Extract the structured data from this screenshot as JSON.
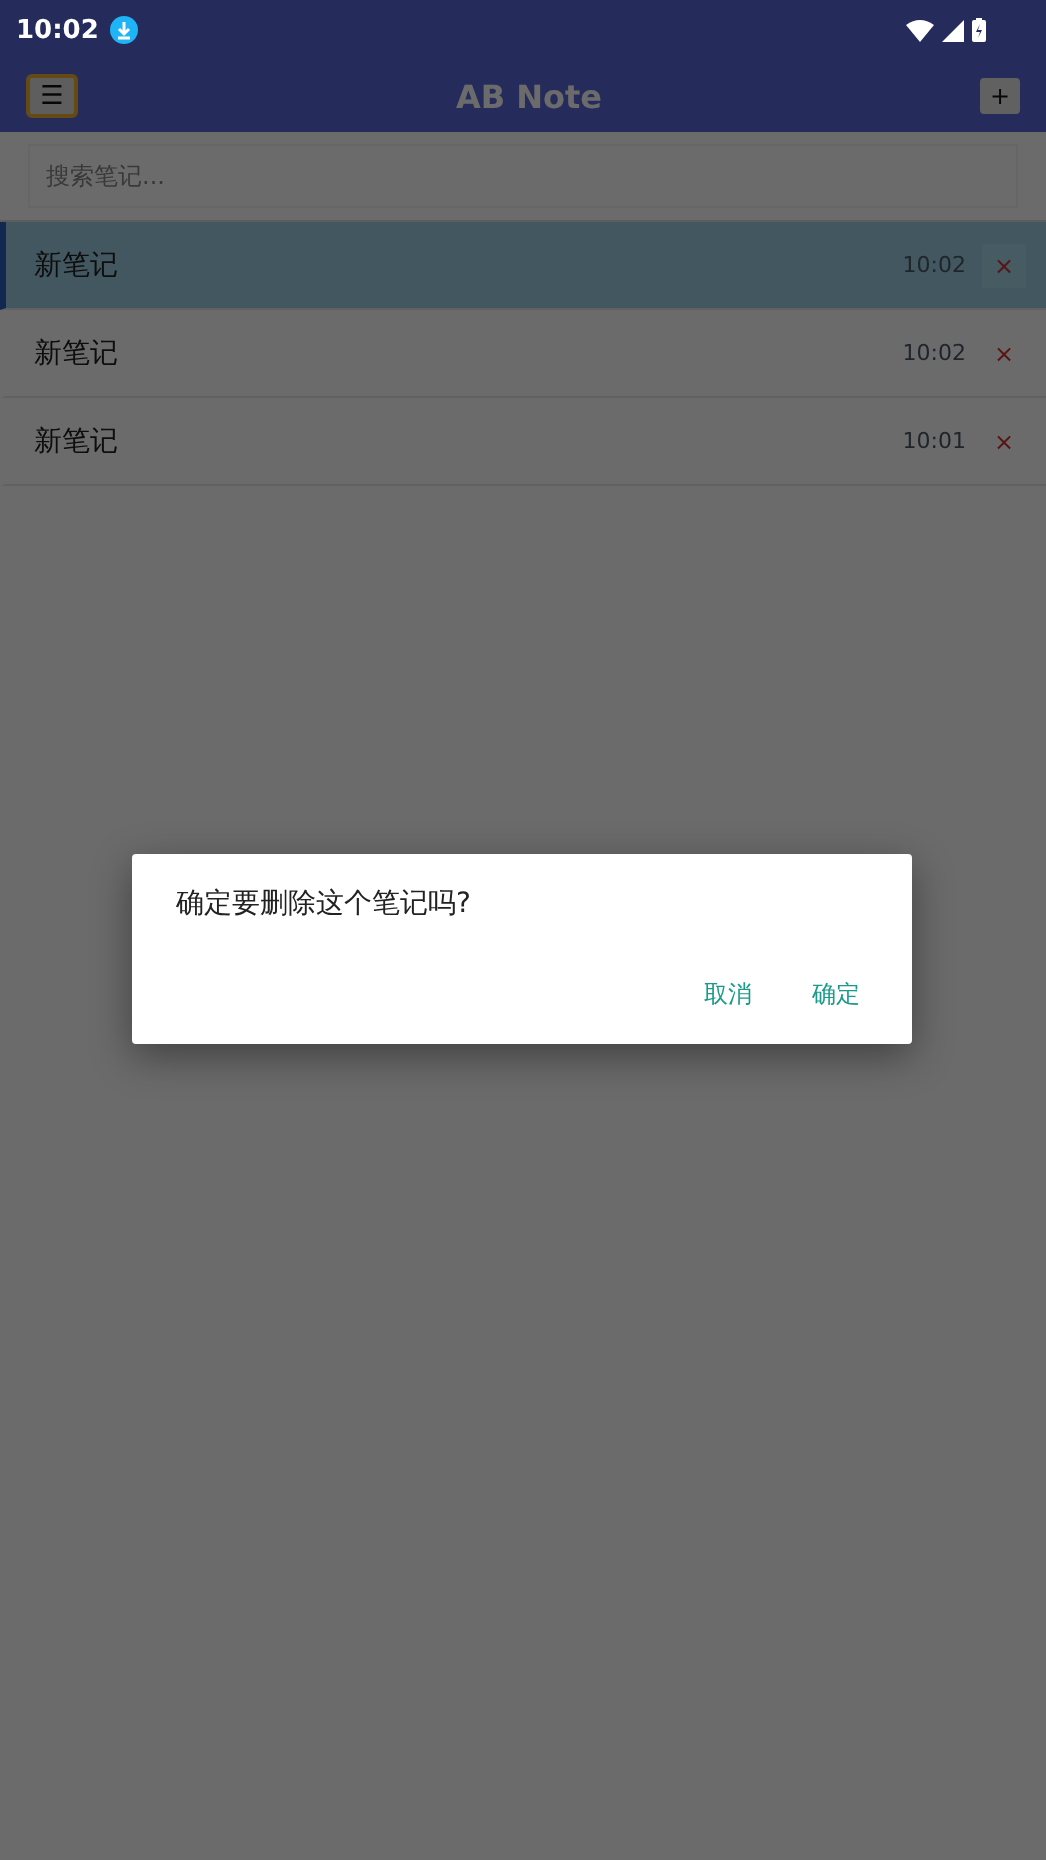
{
  "status_bar": {
    "time": "10:02"
  },
  "header": {
    "menu_button": "☰",
    "title": "AB Note",
    "add_button": "+"
  },
  "search": {
    "placeholder": "搜索笔记..."
  },
  "notes": [
    {
      "title": "新笔记",
      "time": "10:02",
      "delete": "×",
      "selected": true
    },
    {
      "title": "新笔记",
      "time": "10:02",
      "delete": "×",
      "selected": false
    },
    {
      "title": "新笔记",
      "time": "10:01",
      "delete": "×",
      "selected": false
    }
  ],
  "dialog": {
    "message": "确定要删除这个笔记吗?",
    "buttons": [
      "取消",
      "确定"
    ]
  }
}
